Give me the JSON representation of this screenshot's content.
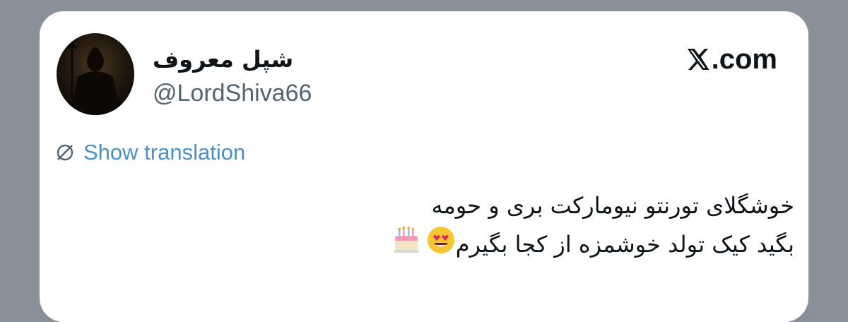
{
  "tweet": {
    "display_name": "شپل معروف",
    "handle": "@LordShiva66",
    "brand": ".com",
    "show_translation_label": "Show translation",
    "text_line_1": "خوشگلای تورنتو نیومارکت بری و حومه",
    "text_line_2": "بگید کیک تولد خوشمزه از کجا بگیرم"
  },
  "icons": {
    "avatar": "avatar-shiva",
    "brand": "x-logo-icon",
    "translate": "translate-globe-icon",
    "emojis": [
      "heart-eyes-emoji-icon",
      "birthday-cake-emoji-icon"
    ]
  },
  "colors": {
    "background": "#8a9099",
    "card": "#ffffff",
    "link": "#4a90c9",
    "text": "#0f1419",
    "muted": "#536471"
  }
}
